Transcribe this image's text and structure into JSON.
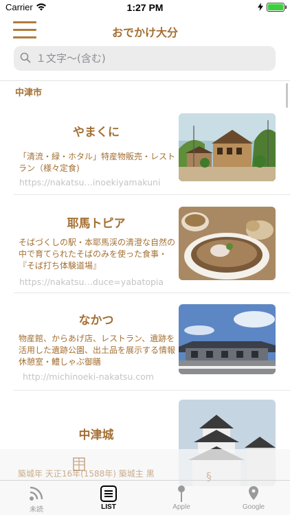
{
  "status": {
    "carrier": "Carrier",
    "time": "1:27 PM"
  },
  "nav": {
    "title": "おでかけ大分"
  },
  "search": {
    "placeholder": "１文字〜(含む)"
  },
  "section": {
    "title": "中津市"
  },
  "items": [
    {
      "title": "やまくに",
      "desc": "「清流・緑・ホタル」特産物販売・レストラン（様々定食)",
      "url": "https://nakatsu…inoekiyamakuni"
    },
    {
      "title": "耶馬トピア",
      "desc": "そばづくしの駅・本耶馬渓の清澄な自然の中で育てられたそばのみを使った食事・『そば打ち体験道場』",
      "url": "https://nakatsu…duce=yabatopia"
    },
    {
      "title": "なかつ",
      "desc": "物産館、からあげ店、レストラン、遺跡を活用した遺跡公園、出土品を展示する情報休憩室・鱧しゃぶ御膳",
      "url": "http://michinoeki-nakatsu.com"
    },
    {
      "title": "中津城",
      "desc": "築城年 天正16年(1588年) 築城主 黒"
    }
  ],
  "tabs": [
    {
      "label": "未読",
      "icon": "rss-icon"
    },
    {
      "label": "LIST",
      "icon": "list-icon",
      "active": true
    },
    {
      "label": "Apple",
      "icon": "map-pin-icon"
    },
    {
      "label": "Google",
      "icon": "location-marker-icon"
    }
  ],
  "colors": {
    "accent": "#a46f33",
    "url": "#c4c4c4",
    "search_bg": "#ececed"
  }
}
